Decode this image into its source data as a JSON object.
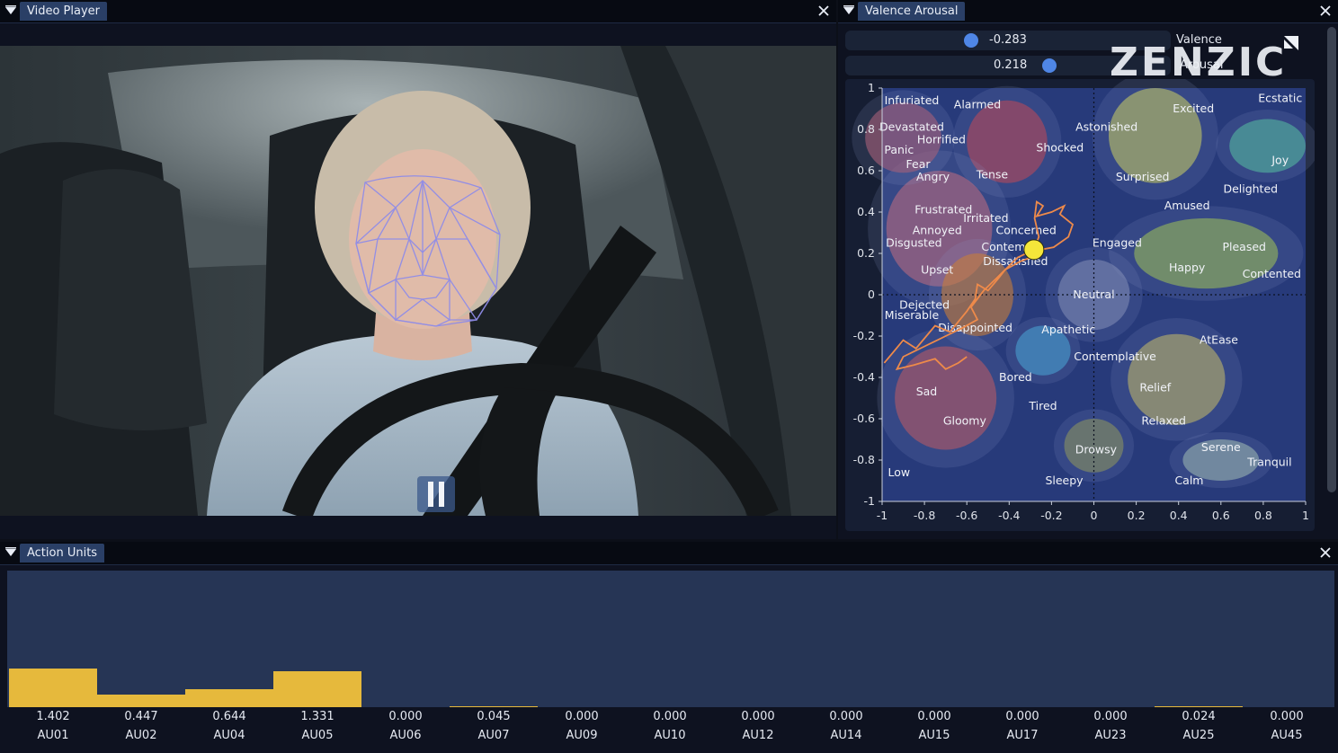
{
  "video_player": {
    "title": "Video Player"
  },
  "valence_arousal": {
    "title": "Valence Arousal",
    "valence_value": "-0.283",
    "valence_label": "Valence",
    "arousal_value": "0.218",
    "arousal_label": "Arousal",
    "brand": "ZENZIC",
    "x_ticks": [
      "-1",
      "-0.8",
      "-0.6",
      "-0.4",
      "-0.2",
      "0",
      "0.2",
      "0.4",
      "0.6",
      "0.8",
      "1"
    ],
    "y_ticks": [
      "1",
      "0.8",
      "0.6",
      "0.4",
      "0.2",
      "0",
      "-0.2",
      "-0.4",
      "-0.6",
      "-0.8",
      "-1"
    ],
    "current_point": {
      "valence": -0.283,
      "arousal": 0.218
    },
    "emotions": [
      {
        "label": "Infuriated",
        "v": -0.86,
        "a": 0.94
      },
      {
        "label": "Alarmed",
        "v": -0.55,
        "a": 0.92
      },
      {
        "label": "Ecstatic",
        "v": 0.88,
        "a": 0.95
      },
      {
        "label": "Excited",
        "v": 0.47,
        "a": 0.9
      },
      {
        "label": "Devastated",
        "v": -0.86,
        "a": 0.81
      },
      {
        "label": "Astonished",
        "v": 0.06,
        "a": 0.81
      },
      {
        "label": "Horrified",
        "v": -0.72,
        "a": 0.75
      },
      {
        "label": "Shocked",
        "v": -0.16,
        "a": 0.71
      },
      {
        "label": "Panic",
        "v": -0.92,
        "a": 0.7
      },
      {
        "label": "Joy",
        "v": 0.88,
        "a": 0.65
      },
      {
        "label": "Fear",
        "v": -0.83,
        "a": 0.63
      },
      {
        "label": "Angry",
        "v": -0.76,
        "a": 0.57
      },
      {
        "label": "Tense",
        "v": -0.48,
        "a": 0.58
      },
      {
        "label": "Surprised",
        "v": 0.23,
        "a": 0.57
      },
      {
        "label": "Delighted",
        "v": 0.74,
        "a": 0.51
      },
      {
        "label": "Amused",
        "v": 0.44,
        "a": 0.43
      },
      {
        "label": "Frustrated",
        "v": -0.71,
        "a": 0.41
      },
      {
        "label": "Irritated",
        "v": -0.51,
        "a": 0.37
      },
      {
        "label": "Concerned",
        "v": -0.32,
        "a": 0.31
      },
      {
        "label": "Annoyed",
        "v": -0.74,
        "a": 0.31
      },
      {
        "label": "Engaged",
        "v": 0.11,
        "a": 0.25
      },
      {
        "label": "Disgusted",
        "v": -0.85,
        "a": 0.25
      },
      {
        "label": "Contempt",
        "v": -0.4,
        "a": 0.23
      },
      {
        "label": "Pleased",
        "v": 0.71,
        "a": 0.23
      },
      {
        "label": "Dissatisfied",
        "v": -0.37,
        "a": 0.16
      },
      {
        "label": "Happy",
        "v": 0.44,
        "a": 0.13
      },
      {
        "label": "Upset",
        "v": -0.74,
        "a": 0.12
      },
      {
        "label": "Contented",
        "v": 0.84,
        "a": 0.1
      },
      {
        "label": "Neutral",
        "v": 0.0,
        "a": 0.0
      },
      {
        "label": "Dejected",
        "v": -0.8,
        "a": -0.05
      },
      {
        "label": "Miserable",
        "v": -0.86,
        "a": -0.1
      },
      {
        "label": "Disappointed",
        "v": -0.56,
        "a": -0.16
      },
      {
        "label": "Apathetic",
        "v": -0.12,
        "a": -0.17
      },
      {
        "label": "AtEase",
        "v": 0.59,
        "a": -0.22
      },
      {
        "label": "Contemplative",
        "v": 0.1,
        "a": -0.3
      },
      {
        "label": "Bored",
        "v": -0.37,
        "a": -0.4
      },
      {
        "label": "Relief",
        "v": 0.29,
        "a": -0.45
      },
      {
        "label": "Sad",
        "v": -0.79,
        "a": -0.47
      },
      {
        "label": "Tired",
        "v": -0.24,
        "a": -0.54
      },
      {
        "label": "Gloomy",
        "v": -0.61,
        "a": -0.61
      },
      {
        "label": "Relaxed",
        "v": 0.33,
        "a": -0.61
      },
      {
        "label": "Drowsy",
        "v": 0.01,
        "a": -0.75
      },
      {
        "label": "Serene",
        "v": 0.6,
        "a": -0.74
      },
      {
        "label": "Tranquil",
        "v": 0.83,
        "a": -0.81
      },
      {
        "label": "Low",
        "v": -0.92,
        "a": -0.86
      },
      {
        "label": "Sleepy",
        "v": -0.14,
        "a": -0.9
      },
      {
        "label": "Calm",
        "v": 0.45,
        "a": -0.9
      }
    ],
    "regions": [
      {
        "v": -0.41,
        "a": 0.74,
        "rv": 0.19,
        "ra": 0.2,
        "color": "#b84a5a"
      },
      {
        "v": -0.73,
        "a": 0.32,
        "rv": 0.25,
        "ra": 0.28,
        "color": "#b86a80"
      },
      {
        "v": -0.9,
        "a": 0.76,
        "rv": 0.18,
        "ra": 0.17,
        "color": "#a6607a"
      },
      {
        "v": -0.55,
        "a": 0.0,
        "rv": 0.17,
        "ra": 0.2,
        "color": "#c77d3a"
      },
      {
        "v": -0.7,
        "a": -0.5,
        "rv": 0.24,
        "ra": 0.25,
        "color": "#b55a66"
      },
      {
        "v": 0.29,
        "a": 0.77,
        "rv": 0.22,
        "ra": 0.23,
        "color": "#c2c666"
      },
      {
        "v": 0.82,
        "a": 0.72,
        "rv": 0.18,
        "ra": 0.13,
        "color": "#55b8a0"
      },
      {
        "v": 0.53,
        "a": 0.2,
        "rv": 0.34,
        "ra": 0.17,
        "color": "#9aba5a"
      },
      {
        "v": 0.39,
        "a": -0.41,
        "rv": 0.23,
        "ra": 0.22,
        "color": "#bcb46a"
      },
      {
        "v": -0.24,
        "a": -0.27,
        "rv": 0.13,
        "ra": 0.12,
        "color": "#4aa0d0"
      },
      {
        "v": 0.0,
        "a": 0.0,
        "rv": 0.17,
        "ra": 0.17,
        "color": "#7e8ab4"
      },
      {
        "v": 0.0,
        "a": -0.73,
        "rv": 0.14,
        "ra": 0.13,
        "color": "#8a9260"
      },
      {
        "v": 0.6,
        "a": -0.8,
        "rv": 0.18,
        "ra": 0.1,
        "color": "#9ab4b0"
      }
    ],
    "trajectory": [
      [
        -0.99,
        -0.33
      ],
      [
        -0.9,
        -0.22
      ],
      [
        -0.84,
        -0.26
      ],
      [
        -0.75,
        -0.15
      ],
      [
        -0.68,
        -0.18
      ],
      [
        -0.6,
        -0.08
      ],
      [
        -0.56,
        -0.02
      ],
      [
        -0.55,
        0.05
      ],
      [
        -0.5,
        0.02
      ],
      [
        -0.45,
        0.08
      ],
      [
        -0.42,
        0.12
      ],
      [
        -0.35,
        0.16
      ],
      [
        -0.3,
        0.18
      ],
      [
        -0.24,
        0.22
      ],
      [
        -0.19,
        0.23
      ],
      [
        -0.12,
        0.28
      ],
      [
        -0.1,
        0.34
      ],
      [
        -0.16,
        0.39
      ],
      [
        -0.14,
        0.43
      ],
      [
        -0.2,
        0.4
      ],
      [
        -0.27,
        0.38
      ],
      [
        -0.24,
        0.43
      ],
      [
        -0.27,
        0.45
      ],
      [
        -0.28,
        0.37
      ],
      [
        -0.26,
        0.28
      ],
      [
        -0.283,
        0.218
      ],
      [
        -0.36,
        0.18
      ],
      [
        -0.42,
        0.12
      ],
      [
        -0.46,
        0.08
      ],
      [
        -0.52,
        0.02
      ],
      [
        -0.58,
        -0.06
      ],
      [
        -0.55,
        -0.12
      ],
      [
        -0.62,
        -0.16
      ],
      [
        -0.7,
        -0.2
      ],
      [
        -0.8,
        -0.25
      ],
      [
        -0.9,
        -0.3
      ],
      [
        -0.93,
        -0.36
      ],
      [
        -0.85,
        -0.34
      ],
      [
        -0.75,
        -0.31
      ],
      [
        -0.7,
        -0.36
      ],
      [
        -0.64,
        -0.33
      ],
      [
        -0.6,
        -0.3
      ]
    ]
  },
  "action_units": {
    "title": "Action Units",
    "units": [
      {
        "name": "AU01",
        "value": "1.402",
        "num": 1.402
      },
      {
        "name": "AU02",
        "value": "0.447",
        "num": 0.447
      },
      {
        "name": "AU04",
        "value": "0.644",
        "num": 0.644
      },
      {
        "name": "AU05",
        "value": "1.331",
        "num": 1.331
      },
      {
        "name": "AU06",
        "value": "0.000",
        "num": 0
      },
      {
        "name": "AU07",
        "value": "0.045",
        "num": 0.045
      },
      {
        "name": "AU09",
        "value": "0.000",
        "num": 0
      },
      {
        "name": "AU10",
        "value": "0.000",
        "num": 0
      },
      {
        "name": "AU12",
        "value": "0.000",
        "num": 0
      },
      {
        "name": "AU14",
        "value": "0.000",
        "num": 0
      },
      {
        "name": "AU15",
        "value": "0.000",
        "num": 0
      },
      {
        "name": "AU17",
        "value": "0.000",
        "num": 0
      },
      {
        "name": "AU23",
        "value": "0.000",
        "num": 0
      },
      {
        "name": "AU25",
        "value": "0.024",
        "num": 0.024
      },
      {
        "name": "AU45",
        "value": "0.000",
        "num": 0
      }
    ],
    "bar_color": "#e6b93c",
    "y_max": 5
  }
}
